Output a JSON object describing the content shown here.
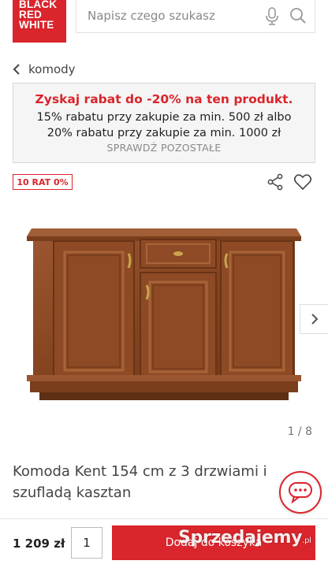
{
  "header": {
    "logo_lines": [
      "BLACK",
      "RED",
      "WHITE"
    ],
    "search_placeholder": "Napisz czego szukasz"
  },
  "breadcrumb": {
    "label": "komody"
  },
  "promo": {
    "title": "Zyskaj rabat do -20% na ten produkt.",
    "text": "15% rabatu przy zakupie za min. 500 zł albo 20% rabatu przy zakupie za min. 1000 zł",
    "link": "SPRAWDŹ POZOSTAŁE"
  },
  "badge": "10 RAT 0%",
  "gallery": {
    "counter": "1 / 8"
  },
  "product": {
    "title": "Komoda Kent 154 cm z 3 drzwiami i szufladą kasztan"
  },
  "purchase": {
    "price": "1 209 zł",
    "quantity": "1",
    "button_label": "Dodaj do koszyka"
  },
  "watermark": {
    "text": "Sprzedajemy",
    "suffix": ".pl"
  },
  "colors": {
    "brand": "#d9252b",
    "wood": "#8b4a26"
  },
  "icons": [
    "chevron-left-icon",
    "microphone-icon",
    "search-icon",
    "share-icon",
    "heart-icon",
    "chevron-right-icon",
    "chat-icon"
  ]
}
